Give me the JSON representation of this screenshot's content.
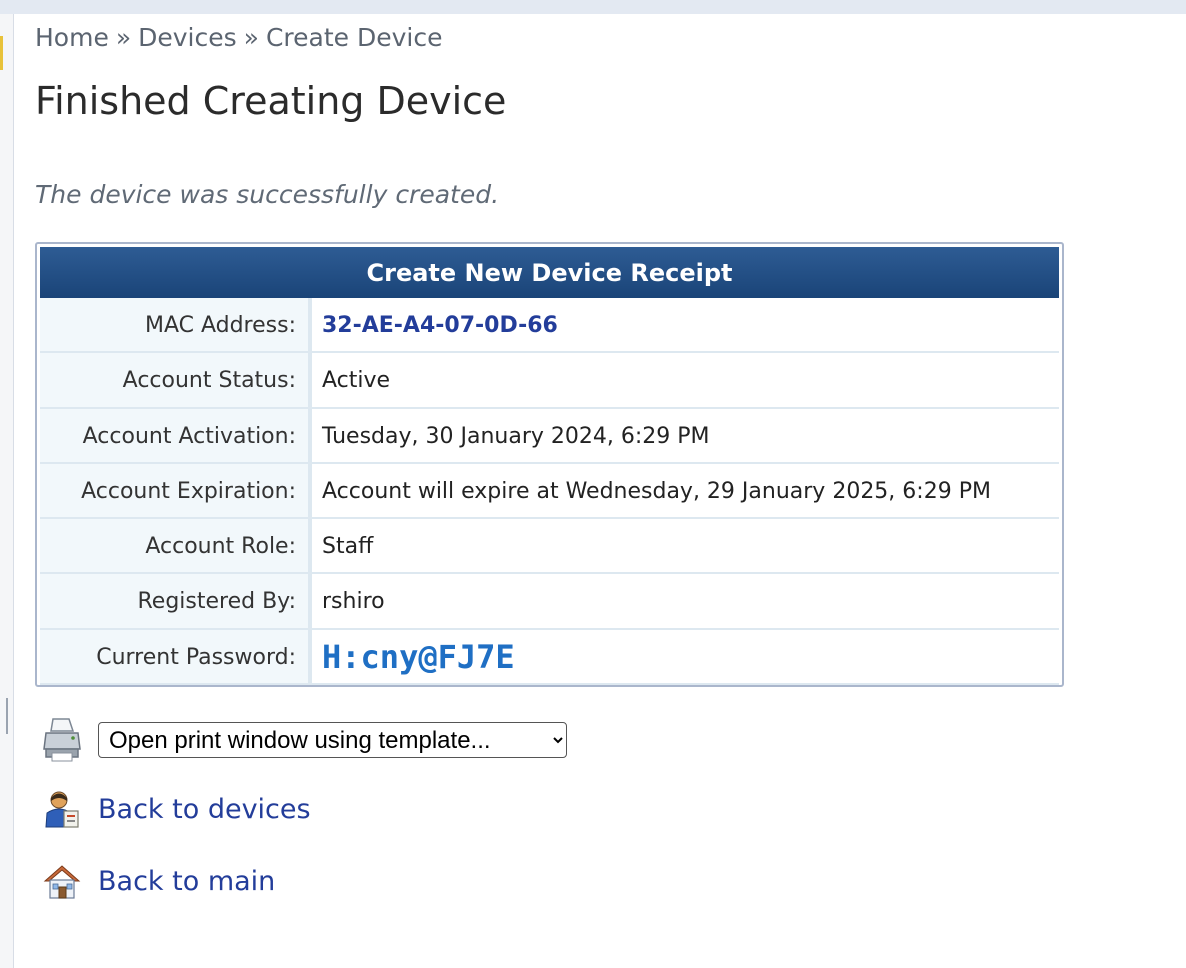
{
  "breadcrumb": {
    "items": [
      "Home",
      "Devices",
      "Create Device"
    ],
    "separator": "»"
  },
  "page": {
    "title": "Finished Creating Device",
    "message": "The device was successfully created."
  },
  "receipt": {
    "title": "Create New Device Receipt",
    "rows": [
      {
        "label": "MAC Address:",
        "value": "32-AE-A4-07-0D-66"
      },
      {
        "label": "Account Status:",
        "value": "Active"
      },
      {
        "label": "Account Activation:",
        "value": "Tuesday, 30 January 2024, 6:29 PM"
      },
      {
        "label": "Account Expiration:",
        "value": "Account will expire at Wednesday, 29 January 2025, 6:29 PM"
      },
      {
        "label": "Account Role:",
        "value": "Staff"
      },
      {
        "label": "Registered By:",
        "value": "rshiro"
      },
      {
        "label": "Current Password:",
        "value": "H:cny@FJ7E"
      }
    ]
  },
  "print": {
    "selected_option": "Open print window using template...",
    "icon": "printer-icon"
  },
  "links": {
    "back_devices": {
      "label": "Back to devices",
      "icon": "devices-icon"
    },
    "back_main": {
      "label": "Back to main",
      "icon": "home-icon"
    }
  },
  "colors": {
    "header_bg": "#1f4c82",
    "link": "#233d9a",
    "password": "#1f6fc4"
  }
}
